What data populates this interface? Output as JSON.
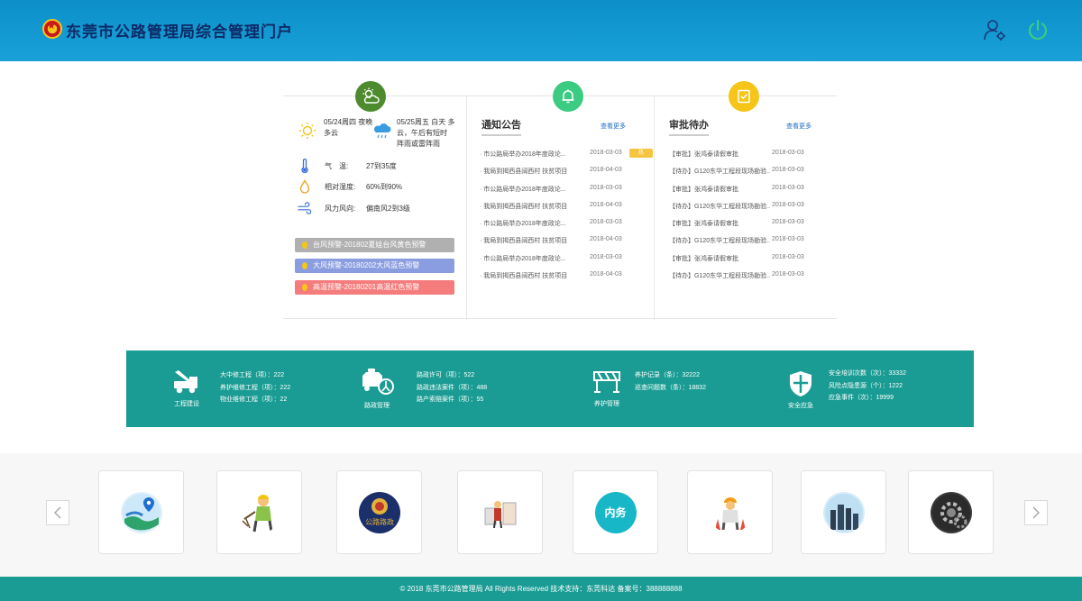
{
  "header": {
    "title": "东莞市公路管理局综合管理门户",
    "brand_color": "#0c8fc9"
  },
  "weather": {
    "day1": "05/24周四 夜晚 多云",
    "day2": "05/25周五 白天 多云，午后有短时 阵雨或雷阵雨",
    "metrics": [
      {
        "icon": "thermometer-icon",
        "label": "气　温:",
        "value": "27到35度"
      },
      {
        "icon": "humidity-icon",
        "label": "相对湿度:",
        "value": "60%到90%"
      },
      {
        "icon": "wind-icon",
        "label": "风力风向:",
        "value": "偏南风2到3级"
      }
    ],
    "alerts": [
      {
        "text": "台风预警-201802夏娃台风黄色预警",
        "color": "#b0b0b0"
      },
      {
        "text": "大风预警-20180202大风蓝色预警",
        "color": "#8a9de0"
      },
      {
        "text": "高温预警-20180201高温红色预警",
        "color": "#f47c7c"
      }
    ]
  },
  "notices": {
    "title": "通知公告",
    "more": "查看更多",
    "hot_label": "热",
    "items": [
      {
        "title": "· 市公路局举办2018年度政论...",
        "date": "2018-03-03"
      },
      {
        "title": "· 我局到揭西县阔西村  扶贫项目",
        "date": "2018-04-03"
      },
      {
        "title": "· 市公路局举办2018年度政论...",
        "date": "2018-03-03"
      },
      {
        "title": "· 我局到揭西县阔西村  扶贫项目",
        "date": "2018-04-03"
      },
      {
        "title": "· 市公路局举办2018年度政论...",
        "date": "2018-03-03"
      },
      {
        "title": "· 我局到揭西县阔西村  扶贫项目",
        "date": "2018-04-03"
      },
      {
        "title": "· 市公路局举办2018年度政论...",
        "date": "2018-03-03"
      },
      {
        "title": "· 我局到揭西县阔西村  扶贫项目",
        "date": "2018-04-03"
      }
    ]
  },
  "approvals": {
    "title": "审批待办",
    "more": "查看更多",
    "items": [
      {
        "title": "【审批】张鸿泰请假审批",
        "date": "2018-03-03"
      },
      {
        "title": "【待办】G120东华工程段现场勘验...",
        "date": "2018-03-03"
      },
      {
        "title": "【审批】张鸿泰请假审批",
        "date": "2018-03-03"
      },
      {
        "title": "【待办】G120东华工程段现场勘验...",
        "date": "2018-03-03"
      },
      {
        "title": "【审批】张鸿泰请假审批",
        "date": "2018-03-03"
      },
      {
        "title": "【待办】G120东华工程段现场勘验...",
        "date": "2018-03-03"
      },
      {
        "title": "【审批】张鸿泰请假审批",
        "date": "2018-03-03"
      },
      {
        "title": "【待办】G120东华工程段现场勘验...",
        "date": "2018-03-03"
      }
    ]
  },
  "stats": [
    {
      "caption": "工程建设",
      "icon": "crane-truck-icon",
      "lines": [
        "大中修工程（项）：222",
        "养护维修工程（项）：222",
        "物业维修工程（项）：22"
      ]
    },
    {
      "caption": "路政管理",
      "icon": "patrol-car-icon",
      "lines": [
        "路政许可（项）：522",
        "路政违法案件（项）：488",
        "路产索赔案件（项）：55"
      ]
    },
    {
      "caption": "养护管理",
      "icon": "road-barrier-icon",
      "lines": [
        "养护记录（条）：32222",
        "巡查问题数（条）：18832"
      ]
    },
    {
      "caption": "安全应急",
      "icon": "shield-icon",
      "lines": [
        "安全培训次数（次）：33332",
        "风险点隐患源（个）：1222",
        "应急事件（次）：19999"
      ]
    }
  ],
  "apps": [
    {
      "name": "map-location-app"
    },
    {
      "name": "road-worker-app"
    },
    {
      "name": "road-admin-badge-app",
      "text": "公路路政"
    },
    {
      "name": "engineering-app"
    },
    {
      "name": "internal-affairs-app",
      "text": "内务"
    },
    {
      "name": "safety-worker-app"
    },
    {
      "name": "city-globe-app"
    },
    {
      "name": "gear-settings-app"
    }
  ],
  "footer": {
    "text": "© 2018 东莞市公路管理局 All Rights Reserved    技术支持：东莞科达   备案号：388888888"
  }
}
